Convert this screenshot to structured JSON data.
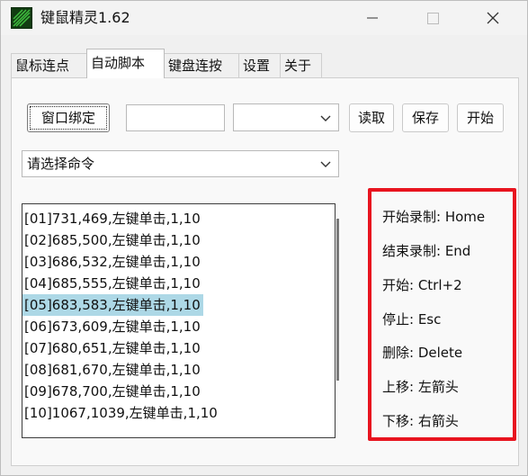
{
  "window": {
    "title": "键鼠精灵1.62",
    "controls": {
      "minimize_icon": "minimize-icon",
      "maximize_icon": "maximize-icon",
      "close_icon": "close-icon"
    }
  },
  "tabs": [
    {
      "label": "鼠标连点"
    },
    {
      "label": "自动脚本"
    },
    {
      "label": "键盘连按"
    },
    {
      "label": "设置"
    },
    {
      "label": "关于"
    }
  ],
  "toolbar": {
    "bind_window_label": "窗口绑定",
    "window_input_value": "",
    "window_select_value": "",
    "read_label": "读取",
    "save_label": "保存",
    "start_label": "开始"
  },
  "command_select": {
    "value": "请选择命令"
  },
  "script_list": [
    "[01]731,469,左键单击,1,10",
    "[02]685,500,左键单击,1,10",
    "[03]686,532,左键单击,1,10",
    "[04]685,555,左键单击,1,10",
    "[05]683,583,左键单击,1,10",
    "[06]673,609,左键单击,1,10",
    "[07]680,651,左键单击,1,10",
    "[08]681,670,左键单击,1,10",
    "[09]678,700,左键单击,1,10",
    "[10]1067,1039,左键单击,1,10"
  ],
  "selected_index": 4,
  "hotkeys": [
    "开始录制: Home",
    "结束录制: End",
    "开始: Ctrl+2",
    "停止: Esc",
    "删除: Delete",
    "上移: 左箭头",
    "下移: 右箭头"
  ],
  "colors": {
    "highlight_border": "#e8141f",
    "selection": "#add8e6"
  }
}
